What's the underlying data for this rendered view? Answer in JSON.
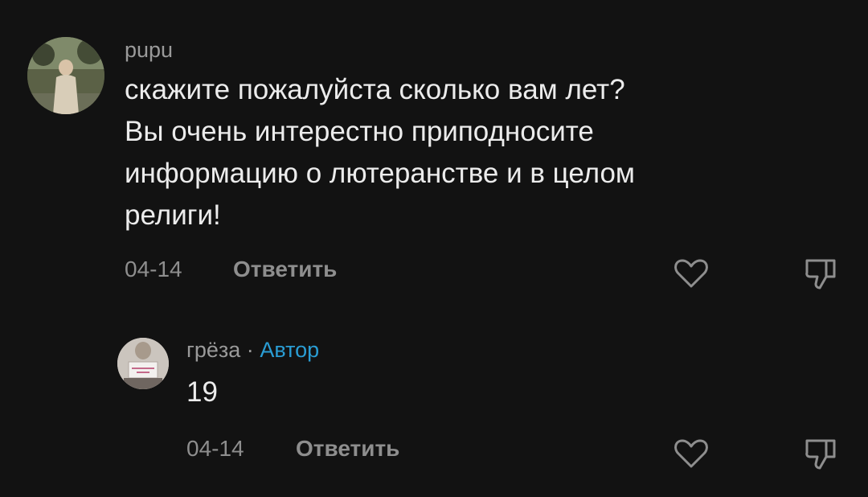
{
  "comments": [
    {
      "username": "pupu",
      "text": "скажите пожалуйста сколько вам лет?\nВы очень интерестно приподносите\nинформацию о лютеранстве и в целом\nрелиги!",
      "date": "04-14",
      "reply_label": "Ответить"
    },
    {
      "username": "грёза",
      "separator": "·",
      "author_badge": "Автор",
      "text": "19",
      "date": "04-14",
      "reply_label": "Ответить"
    }
  ],
  "icons": {
    "like": "heart-outline-icon",
    "dislike": "thumbs-down-outline-icon"
  },
  "colors": {
    "background": "#121212",
    "text": "#ececec",
    "muted": "#8e8e8e",
    "author_badge": "#2a9dd4"
  }
}
